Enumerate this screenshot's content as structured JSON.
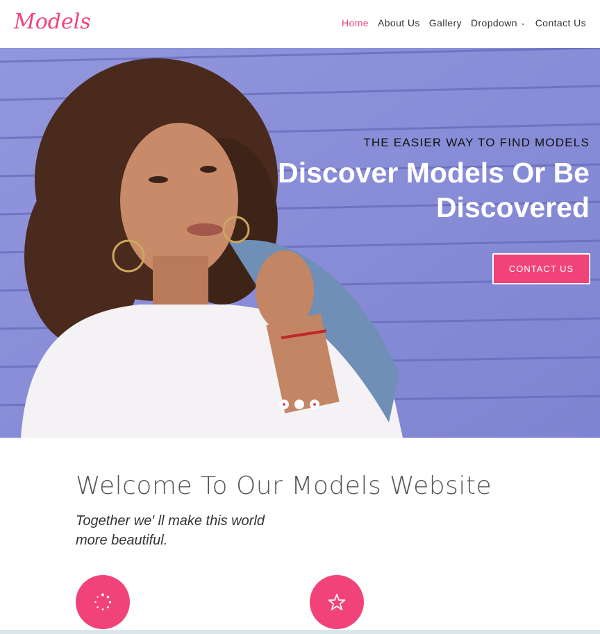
{
  "logo": {
    "text": "Models"
  },
  "nav": {
    "items": [
      {
        "label": "Home",
        "active": true
      },
      {
        "label": "About Us"
      },
      {
        "label": "Gallery"
      },
      {
        "label": "Dropdown",
        "has_chevron": true
      },
      {
        "label": "Contact Us"
      }
    ]
  },
  "hero": {
    "subtitle": "THE EASIER WAY TO FIND MODELS",
    "title_line1": "Discover Models Or Be",
    "title_line2": "Discovered",
    "button_label": "CONTACT US",
    "slides": 3,
    "active_slide": 2
  },
  "welcome": {
    "title": "Welcome To Our Models Website",
    "subtitle_line1": "Together we′ ll make this world",
    "subtitle_line2": "more beautiful."
  },
  "features": [
    {
      "icon": "loading-spinner-icon"
    },
    {
      "icon": "star-icon"
    }
  ],
  "colors": {
    "accent": "#f2427a",
    "hero_bg": "#8b90d8"
  }
}
